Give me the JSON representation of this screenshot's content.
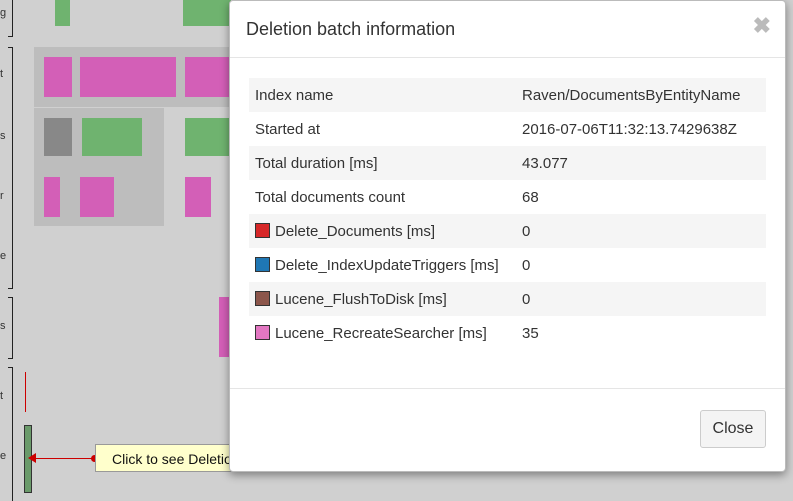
{
  "background": {
    "labels": [
      "g",
      "t",
      "s",
      "r",
      "e",
      "s",
      "t",
      "e"
    ]
  },
  "modal": {
    "title": "Deletion batch information",
    "close_glyph": "✖",
    "rows": [
      {
        "key": "Index name",
        "value": "Raven/DocumentsByEntityName",
        "swatch": ""
      },
      {
        "key": "Started at",
        "value": "2016-07-06T11:32:13.7429638Z",
        "swatch": ""
      },
      {
        "key": "Total duration [ms]",
        "value": "43.077",
        "swatch": ""
      },
      {
        "key": "Total documents count",
        "value": "68",
        "swatch": ""
      },
      {
        "key": "Delete_Documents [ms]",
        "value": "0",
        "swatch": "#d62728"
      },
      {
        "key": "Delete_IndexUpdateTriggers [ms]",
        "value": "0",
        "swatch": "#1f77b4"
      },
      {
        "key": "Lucene_FlushToDisk [ms]",
        "value": "0",
        "swatch": "#8c564b"
      },
      {
        "key": "Lucene_RecreateSearcher [ms]",
        "value": "35",
        "swatch": "#e377c2"
      }
    ],
    "close_button": "Close"
  },
  "tooltip": {
    "text": "Click to see Deletion batch information"
  }
}
